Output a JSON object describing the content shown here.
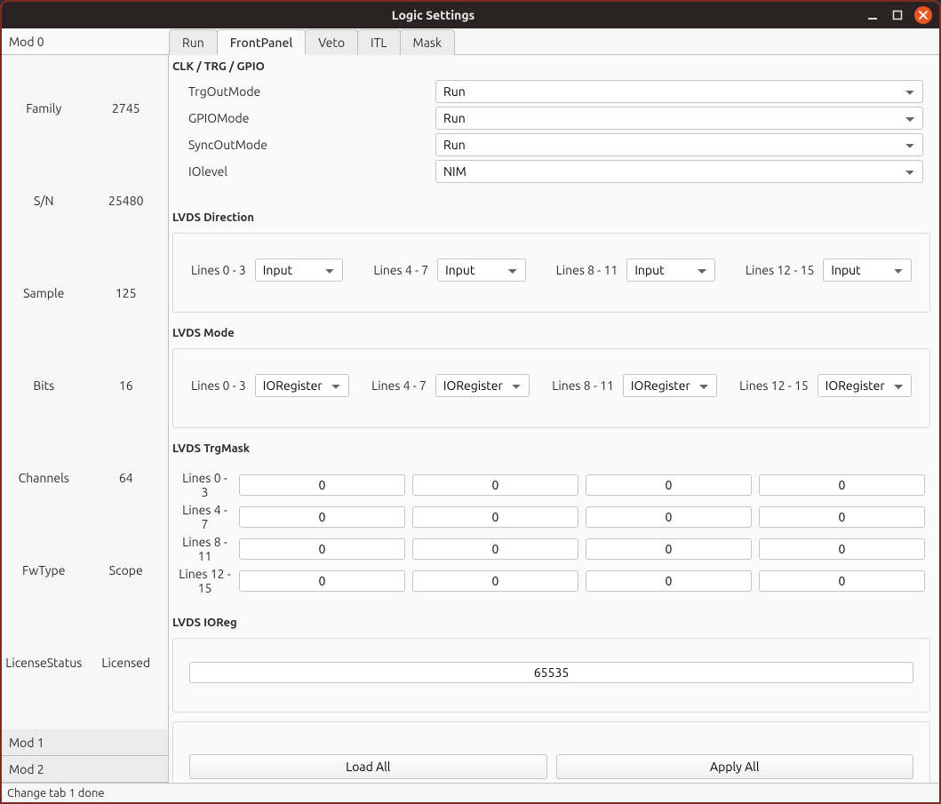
{
  "window": {
    "title": "Logic Settings"
  },
  "mod_tabs": {
    "items": [
      {
        "label": "Mod 0",
        "active": true
      },
      {
        "label": "Mod 1",
        "active": false
      },
      {
        "label": "Mod 2",
        "active": false
      }
    ]
  },
  "sidebar": {
    "rows": [
      {
        "label": "Family",
        "value": "2745"
      },
      {
        "label": "S/N",
        "value": "25480"
      },
      {
        "label": "Sample",
        "value": "125"
      },
      {
        "label": "Bits",
        "value": "16"
      },
      {
        "label": "Channels",
        "value": "64"
      },
      {
        "label": "FwType",
        "value": "Scope"
      },
      {
        "label": "LicenseStatus",
        "value": "Licensed"
      }
    ]
  },
  "top_tabs": {
    "items": [
      {
        "label": "Run",
        "active": false
      },
      {
        "label": "FrontPanel",
        "active": true
      },
      {
        "label": "Veto",
        "active": false
      },
      {
        "label": "ITL",
        "active": false
      },
      {
        "label": "Mask",
        "active": false
      }
    ]
  },
  "clk_section": {
    "title": "CLK / TRG / GPIO",
    "rows": [
      {
        "label": "TrgOutMode",
        "value": "Run"
      },
      {
        "label": "GPIOMode",
        "value": "Run"
      },
      {
        "label": "SyncOutMode",
        "value": "Run"
      },
      {
        "label": "IOlevel",
        "value": "NIM"
      }
    ]
  },
  "lvds_direction": {
    "title": "LVDS Direction",
    "groups": [
      {
        "label": "Lines 0 - 3",
        "value": "Input"
      },
      {
        "label": "Lines 4 - 7",
        "value": "Input"
      },
      {
        "label": "Lines 8 - 11",
        "value": "Input"
      },
      {
        "label": "Lines 12 - 15",
        "value": "Input"
      }
    ]
  },
  "lvds_mode": {
    "title": "LVDS Mode",
    "groups": [
      {
        "label": "Lines 0 - 3",
        "value": "IORegister"
      },
      {
        "label": "Lines 4 - 7",
        "value": "IORegister"
      },
      {
        "label": "Lines 8 - 11",
        "value": "IORegister"
      },
      {
        "label": "Lines 12 - 15",
        "value": "IORegister"
      }
    ]
  },
  "lvds_trgmask": {
    "title": "LVDS TrgMask",
    "rows": [
      {
        "label": "Lines 0 - 3",
        "values": [
          "0",
          "0",
          "0",
          "0"
        ]
      },
      {
        "label": "Lines 4 - 7",
        "values": [
          "0",
          "0",
          "0",
          "0"
        ]
      },
      {
        "label": "Lines 8 - 11",
        "values": [
          "0",
          "0",
          "0",
          "0"
        ]
      },
      {
        "label": "Lines 12 - 15",
        "values": [
          "0",
          "0",
          "0",
          "0"
        ]
      }
    ]
  },
  "lvds_ioreg": {
    "title": "LVDS IOReg",
    "value": "65535"
  },
  "buttons": {
    "load_all": "Load All",
    "apply_all": "Apply All"
  },
  "statusbar": {
    "text": "Change tab 1 done"
  }
}
